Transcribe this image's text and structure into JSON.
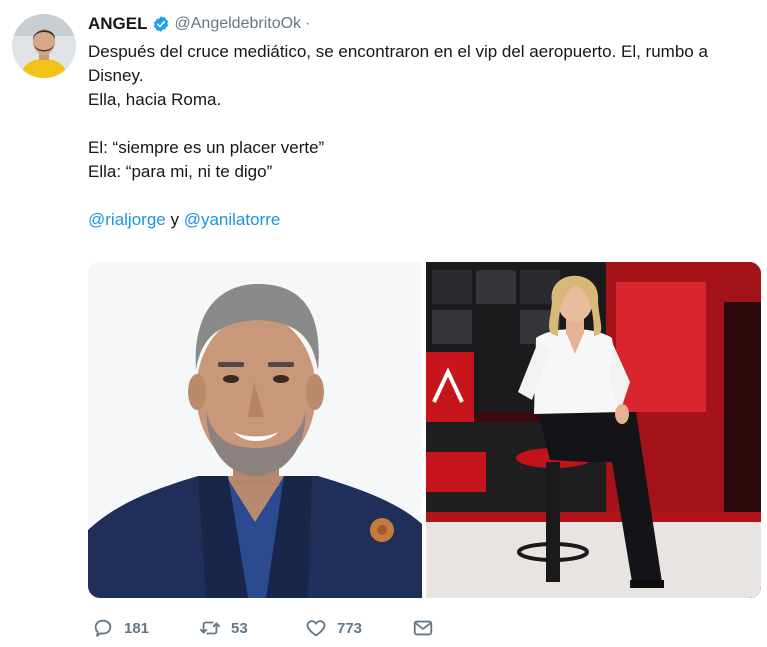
{
  "author": {
    "name": "ANGEL",
    "handle": "@AngeldebritoOk",
    "separator": "·",
    "verified": true,
    "avatar_icon": "avatar-photo"
  },
  "tweet": {
    "line1": "Después del cruce mediático, se encontraron en el vip del aeropuerto. El, rumbo a Disney.",
    "line2": "Ella, hacia Roma.",
    "line3": "El: “siempre es un placer verte”",
    "line4": "Ella: “para mi, ni te digo”",
    "mention1": "@rialjorge",
    "connector": "y",
    "mention2": "@yanilatorre"
  },
  "media": {
    "left_photo": "photo-man-portrait",
    "right_photo": "photo-woman-tv-studio"
  },
  "actions": {
    "reply_icon": "reply-icon",
    "reply_count": "181",
    "retweet_icon": "retweet-icon",
    "retweet_count": "53",
    "like_icon": "heart-icon",
    "like_count": "773",
    "dm_icon": "envelope-icon"
  },
  "colors": {
    "link": "#1b95e0",
    "muted": "#657786",
    "text": "#14171a"
  }
}
